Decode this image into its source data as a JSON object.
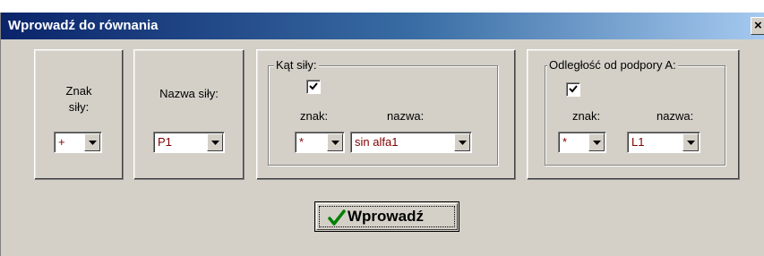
{
  "window": {
    "title": "Wprowadź do równania",
    "close_label": "×"
  },
  "sign_panel": {
    "label_line1": "Znak",
    "label_line2": "siły:",
    "value": "+"
  },
  "name_panel": {
    "label": "Nazwa siły:",
    "value": "P1"
  },
  "angle_group": {
    "legend": "Kąt siły:",
    "checked": true,
    "sign_label": "znak:",
    "name_label": "nazwa:",
    "sign_value": "*",
    "name_value": "sin alfa1"
  },
  "distance_group": {
    "legend": "Odległość od podpory A:",
    "checked": true,
    "sign_label": "znak:",
    "name_label": "nazwa:",
    "sign_value": "*",
    "name_value": "L1"
  },
  "submit_button": {
    "label": "Wprowadź",
    "icon": "checkmark-icon",
    "icon_color": "#008000"
  },
  "colors": {
    "title_bar_start": "#0a246a",
    "title_bar_end": "#a6caf0",
    "dialog_face": "#d4d0c8",
    "combo_text": "#800000"
  }
}
